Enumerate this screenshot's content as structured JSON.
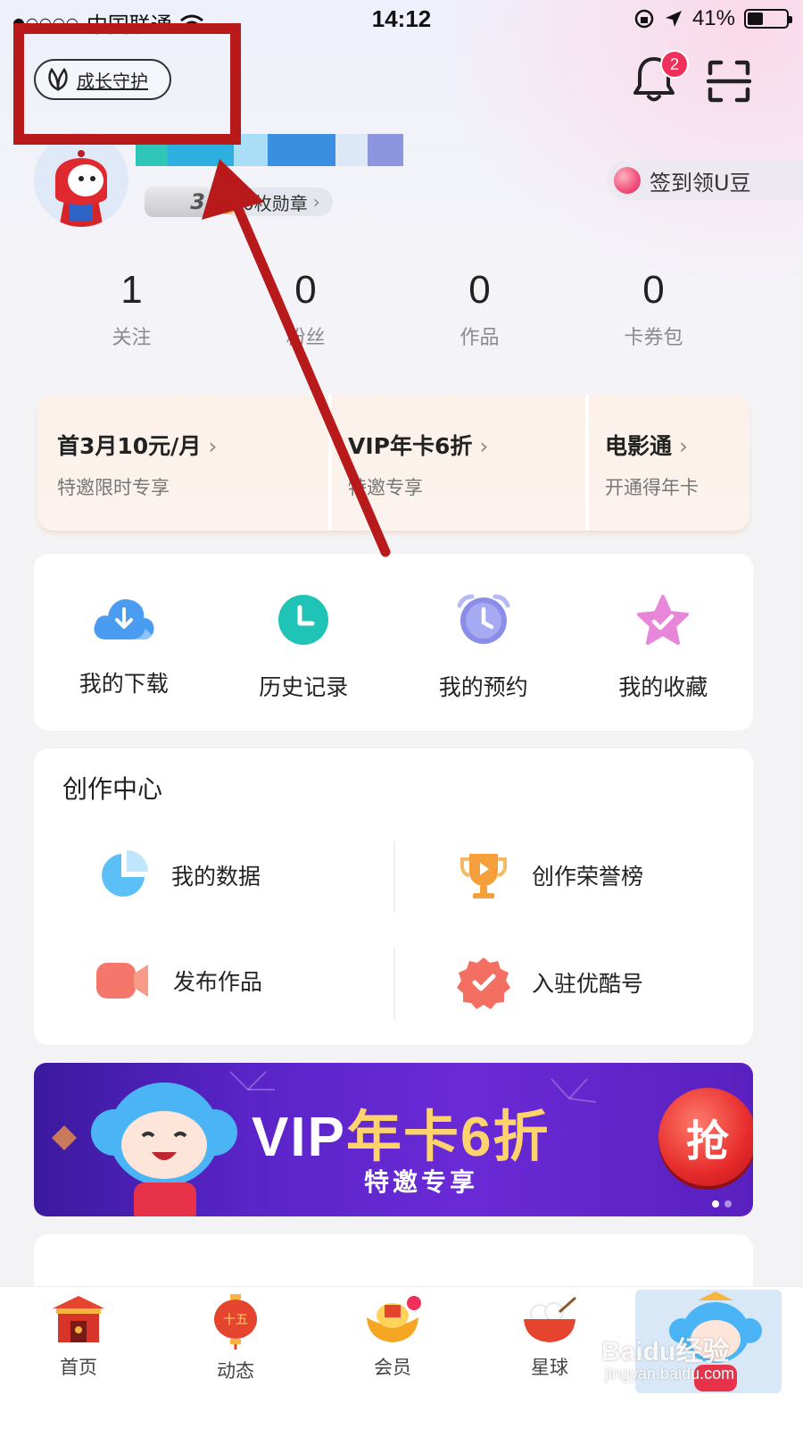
{
  "status_bar": {
    "signal_dots": "●○○○○",
    "carrier": "中国联通",
    "time": "14:12",
    "battery_percent": "41%",
    "battery_level": 0.41
  },
  "header": {
    "growth_guard_label": "成长守护",
    "notification_count": "2"
  },
  "profile": {
    "level_number": "3",
    "medal_text": "0枚勋章",
    "checkin_label": "签到领U豆"
  },
  "stats": [
    {
      "value": "1",
      "label": "关注"
    },
    {
      "value": "0",
      "label": "粉丝"
    },
    {
      "value": "0",
      "label": "作品"
    },
    {
      "value": "0",
      "label": "卡券包"
    }
  ],
  "promos": [
    {
      "title": "首3月10元/月",
      "subtitle": "特邀限时专享"
    },
    {
      "title": "VIP年卡6折",
      "subtitle": "特邀专享"
    },
    {
      "title": "电影通",
      "subtitle": "开通得年卡"
    }
  ],
  "quick_actions": [
    {
      "label": "我的下载",
      "icon": "download-cloud-icon"
    },
    {
      "label": "历史记录",
      "icon": "clock-icon"
    },
    {
      "label": "我的预约",
      "icon": "alarm-clock-icon"
    },
    {
      "label": "我的收藏",
      "icon": "star-icon"
    }
  ],
  "creation_center": {
    "title": "创作中心",
    "items": [
      {
        "label": "我的数据",
        "icon": "pie-chart-icon"
      },
      {
        "label": "创作荣誉榜",
        "icon": "trophy-icon"
      },
      {
        "label": "发布作品",
        "icon": "video-camera-icon"
      },
      {
        "label": "入驻优酷号",
        "icon": "verified-badge-icon"
      }
    ]
  },
  "banner": {
    "headline_vip": "VIP",
    "headline_offer": "年卡6折",
    "subline": "特邀专享",
    "grab_button": "抢"
  },
  "tabbar": [
    {
      "label": "首页",
      "icon": "temple-gate-icon"
    },
    {
      "label": "动态",
      "icon": "lantern-icon"
    },
    {
      "label": "会员",
      "icon": "gold-ingot-icon"
    },
    {
      "label": "星球",
      "icon": "bowl-icon"
    },
    {
      "label": "",
      "icon": "monkey-mascot-icon"
    }
  ],
  "watermark": {
    "text": "Baidu经验",
    "url": "jingyan.baidu.com"
  },
  "colors": {
    "annotation_red": "#b8191b",
    "badge_pink": "#f0305a",
    "banner_purple": "#5a24c8"
  }
}
